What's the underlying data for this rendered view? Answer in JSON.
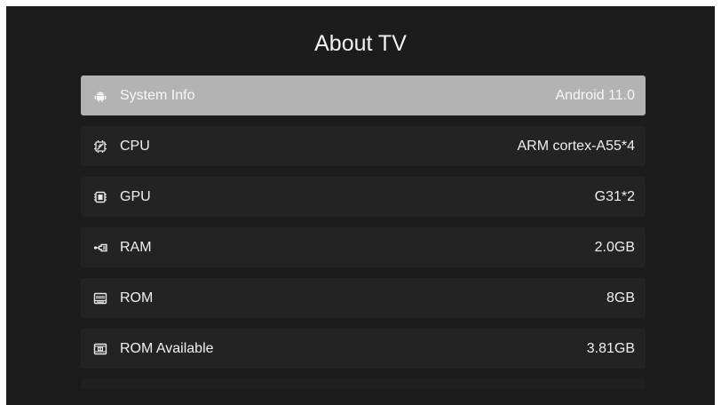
{
  "page": {
    "title": "About TV"
  },
  "items": [
    {
      "icon": "android-icon",
      "label": "System Info",
      "value": "Android 11.0",
      "selected": true
    },
    {
      "icon": "cpu-icon",
      "label": "CPU",
      "value": "ARM cortex-A55*4",
      "selected": false
    },
    {
      "icon": "chip-icon",
      "label": "GPU",
      "value": "G31*2",
      "selected": false
    },
    {
      "icon": "ram-icon",
      "label": "RAM",
      "value": "2.0GB",
      "selected": false
    },
    {
      "icon": "storage-icon",
      "label": "ROM",
      "value": "8GB",
      "selected": false
    },
    {
      "icon": "storage-available-icon",
      "label": "ROM Available",
      "value": "3.81GB",
      "selected": false
    }
  ],
  "colors": {
    "background": "#1c1c1c",
    "row": "#232323",
    "selected_row": "#b3b3b3",
    "text": "#f0f0f0"
  }
}
